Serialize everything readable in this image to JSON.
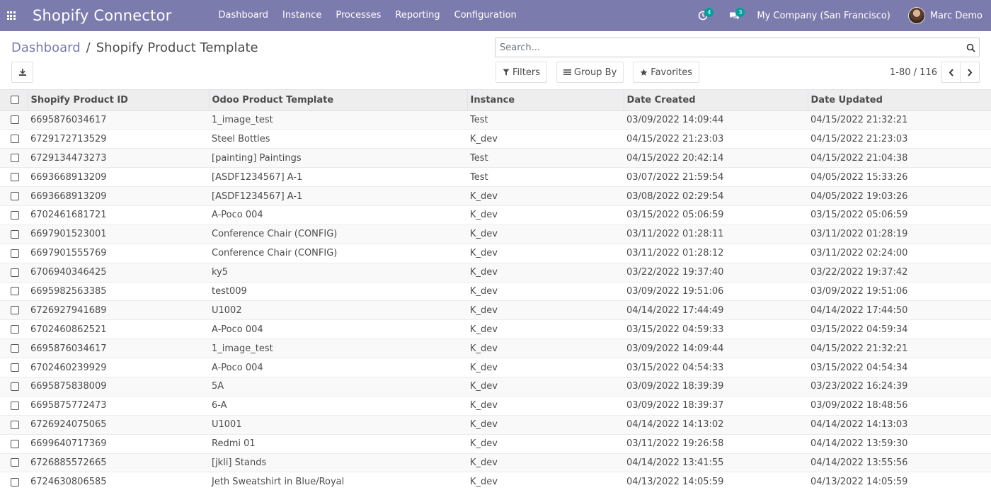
{
  "navbar": {
    "brand": "Shopify Connector",
    "menu": [
      "Dashboard",
      "Instance",
      "Processes",
      "Reporting",
      "Configuration"
    ],
    "activity_count": "4",
    "messages_count": "3",
    "company": "My Company (San Francisco)",
    "user": "Marc Demo",
    "bg_color": "#7c7bad",
    "badge_color": "#00a09d"
  },
  "breadcrumb": {
    "parent": "Dashboard",
    "separator": "/",
    "current": "Shopify Product Template"
  },
  "search": {
    "placeholder": "Search..."
  },
  "filters": {
    "filters": "Filters",
    "group_by": "Group By",
    "favorites": "Favorites"
  },
  "pager": {
    "value": "1-80 / 116"
  },
  "table": {
    "columns": [
      "Shopify Product ID",
      "Odoo Product Template",
      "Instance",
      "Date Created",
      "Date Updated"
    ],
    "rows": [
      [
        "6695876034617",
        "1_image_test",
        "Test",
        "03/09/2022 14:09:44",
        "04/15/2022 21:32:21"
      ],
      [
        "6729172713529",
        "Steel Bottles",
        "K_dev",
        "04/15/2022 21:23:03",
        "04/15/2022 21:23:03"
      ],
      [
        "6729134473273",
        "[painting] Paintings",
        "Test",
        "04/15/2022 20:42:14",
        "04/15/2022 21:04:38"
      ],
      [
        "6693668913209",
        "[ASDF1234567] A-1",
        "Test",
        "03/07/2022 21:59:54",
        "04/05/2022 15:33:26"
      ],
      [
        "6693668913209",
        "[ASDF1234567] A-1",
        "K_dev",
        "03/08/2022 02:29:54",
        "04/05/2022 19:03:26"
      ],
      [
        "6702461681721",
        "A-Poco 004",
        "K_dev",
        "03/15/2022 05:06:59",
        "03/15/2022 05:06:59"
      ],
      [
        "6697901523001",
        "Conference Chair (CONFIG)",
        "K_dev",
        "03/11/2022 01:28:11",
        "03/11/2022 01:28:19"
      ],
      [
        "6697901555769",
        "Conference Chair (CONFIG)",
        "K_dev",
        "03/11/2022 01:28:12",
        "03/11/2022 02:24:00"
      ],
      [
        "6706940346425",
        "ky5",
        "K_dev",
        "03/22/2022 19:37:40",
        "03/22/2022 19:37:42"
      ],
      [
        "6695982563385",
        "test009",
        "K_dev",
        "03/09/2022 19:51:06",
        "03/09/2022 19:51:06"
      ],
      [
        "6726927941689",
        "U1002",
        "K_dev",
        "04/14/2022 17:44:49",
        "04/14/2022 17:44:50"
      ],
      [
        "6702460862521",
        "A-Poco 004",
        "K_dev",
        "03/15/2022 04:59:33",
        "03/15/2022 04:59:34"
      ],
      [
        "6695876034617",
        "1_image_test",
        "K_dev",
        "03/09/2022 14:09:44",
        "04/15/2022 21:32:21"
      ],
      [
        "6702460239929",
        "A-Poco 004",
        "K_dev",
        "03/15/2022 04:54:33",
        "03/15/2022 04:54:34"
      ],
      [
        "6695875838009",
        "5A",
        "K_dev",
        "03/09/2022 18:39:39",
        "03/23/2022 16:24:39"
      ],
      [
        "6695875772473",
        "6-A",
        "K_dev",
        "03/09/2022 18:39:37",
        "03/09/2022 18:48:56"
      ],
      [
        "6726924075065",
        "U1001",
        "K_dev",
        "04/14/2022 14:13:02",
        "04/14/2022 14:13:03"
      ],
      [
        "6699640717369",
        "Redmi 01",
        "K_dev",
        "03/11/2022 19:26:58",
        "04/14/2022 13:59:30"
      ],
      [
        "6726885572665",
        "[jkli] Stands",
        "K_dev",
        "04/14/2022 13:41:55",
        "04/14/2022 13:55:56"
      ],
      [
        "6724630806585",
        "Jeth Sweatshirt in Blue/Royal",
        "K_dev",
        "04/13/2022 14:05:59",
        "04/13/2022 14:05:59"
      ]
    ]
  }
}
